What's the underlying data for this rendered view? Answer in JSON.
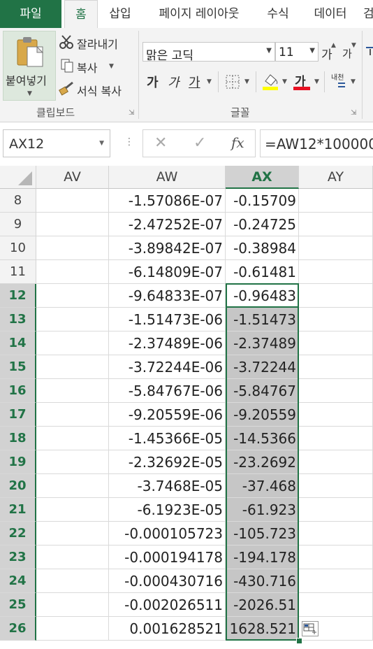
{
  "ribbon_tabs": [
    "파일",
    "홈",
    "삽입",
    "페이지 레이아웃",
    "수식",
    "데이터",
    "검"
  ],
  "clipboard": {
    "paste_label": "붙여넣기",
    "cut_label": "잘라내기",
    "copy_label": "복사",
    "format_painter_label": "서식 복사",
    "group_label": "클립보드"
  },
  "font": {
    "font_name": "맑은 고딕",
    "font_size": "11",
    "grow_label": "가",
    "shrink_label": "가",
    "bold_label": "가",
    "italic_label": "가",
    "underline_label": "가",
    "font_color_label": "가",
    "font_color": "#e81123",
    "fill_color": "#ffff00",
    "phonetic_label": "내천",
    "group_label": "글꼴"
  },
  "formula_bar": {
    "name_box": "AX12",
    "cancel_icon": "✕",
    "enter_icon": "✓",
    "function_label": "fx",
    "formula": "=AW12*100000"
  },
  "columns": [
    "AV",
    "AW",
    "AX",
    "AY"
  ],
  "selected_column": "AX",
  "rows": [
    {
      "row": "8",
      "aw": "-1.57086E-07",
      "ax": "-0.15709"
    },
    {
      "row": "9",
      "aw": "-2.47252E-07",
      "ax": "-0.24725"
    },
    {
      "row": "10",
      "aw": "-3.89842E-07",
      "ax": "-0.38984"
    },
    {
      "row": "11",
      "aw": "-6.14809E-07",
      "ax": "-0.61481"
    },
    {
      "row": "12",
      "aw": "-9.64833E-07",
      "ax": "-0.96483"
    },
    {
      "row": "13",
      "aw": "-1.51473E-06",
      "ax": "-1.51473"
    },
    {
      "row": "14",
      "aw": "-2.37489E-06",
      "ax": "-2.37489"
    },
    {
      "row": "15",
      "aw": "-3.72244E-06",
      "ax": "-3.72244"
    },
    {
      "row": "16",
      "aw": "-5.84767E-06",
      "ax": "-5.84767"
    },
    {
      "row": "17",
      "aw": "-9.20559E-06",
      "ax": "-9.20559"
    },
    {
      "row": "18",
      "aw": "-1.45366E-05",
      "ax": "-14.5366"
    },
    {
      "row": "19",
      "aw": "-2.32692E-05",
      "ax": "-23.2692"
    },
    {
      "row": "20",
      "aw": "-3.7468E-05",
      "ax": "-37.468"
    },
    {
      "row": "21",
      "aw": "-6.1923E-05",
      "ax": "-61.923"
    },
    {
      "row": "22",
      "aw": "-0.000105723",
      "ax": "-105.723"
    },
    {
      "row": "23",
      "aw": "-0.000194178",
      "ax": "-194.178"
    },
    {
      "row": "24",
      "aw": "-0.000430716",
      "ax": "-430.716"
    },
    {
      "row": "25",
      "aw": "-0.002026511",
      "ax": "-2026.51"
    },
    {
      "row": "26",
      "aw": "0.001628521",
      "ax": "1628.521"
    }
  ],
  "selection": {
    "first_row": "12",
    "last_row": "26",
    "active_row": "12"
  },
  "colors": {
    "accent": "#217346",
    "selection_fill": "#c6c6c6",
    "header_fill": "#f3f3f3"
  }
}
